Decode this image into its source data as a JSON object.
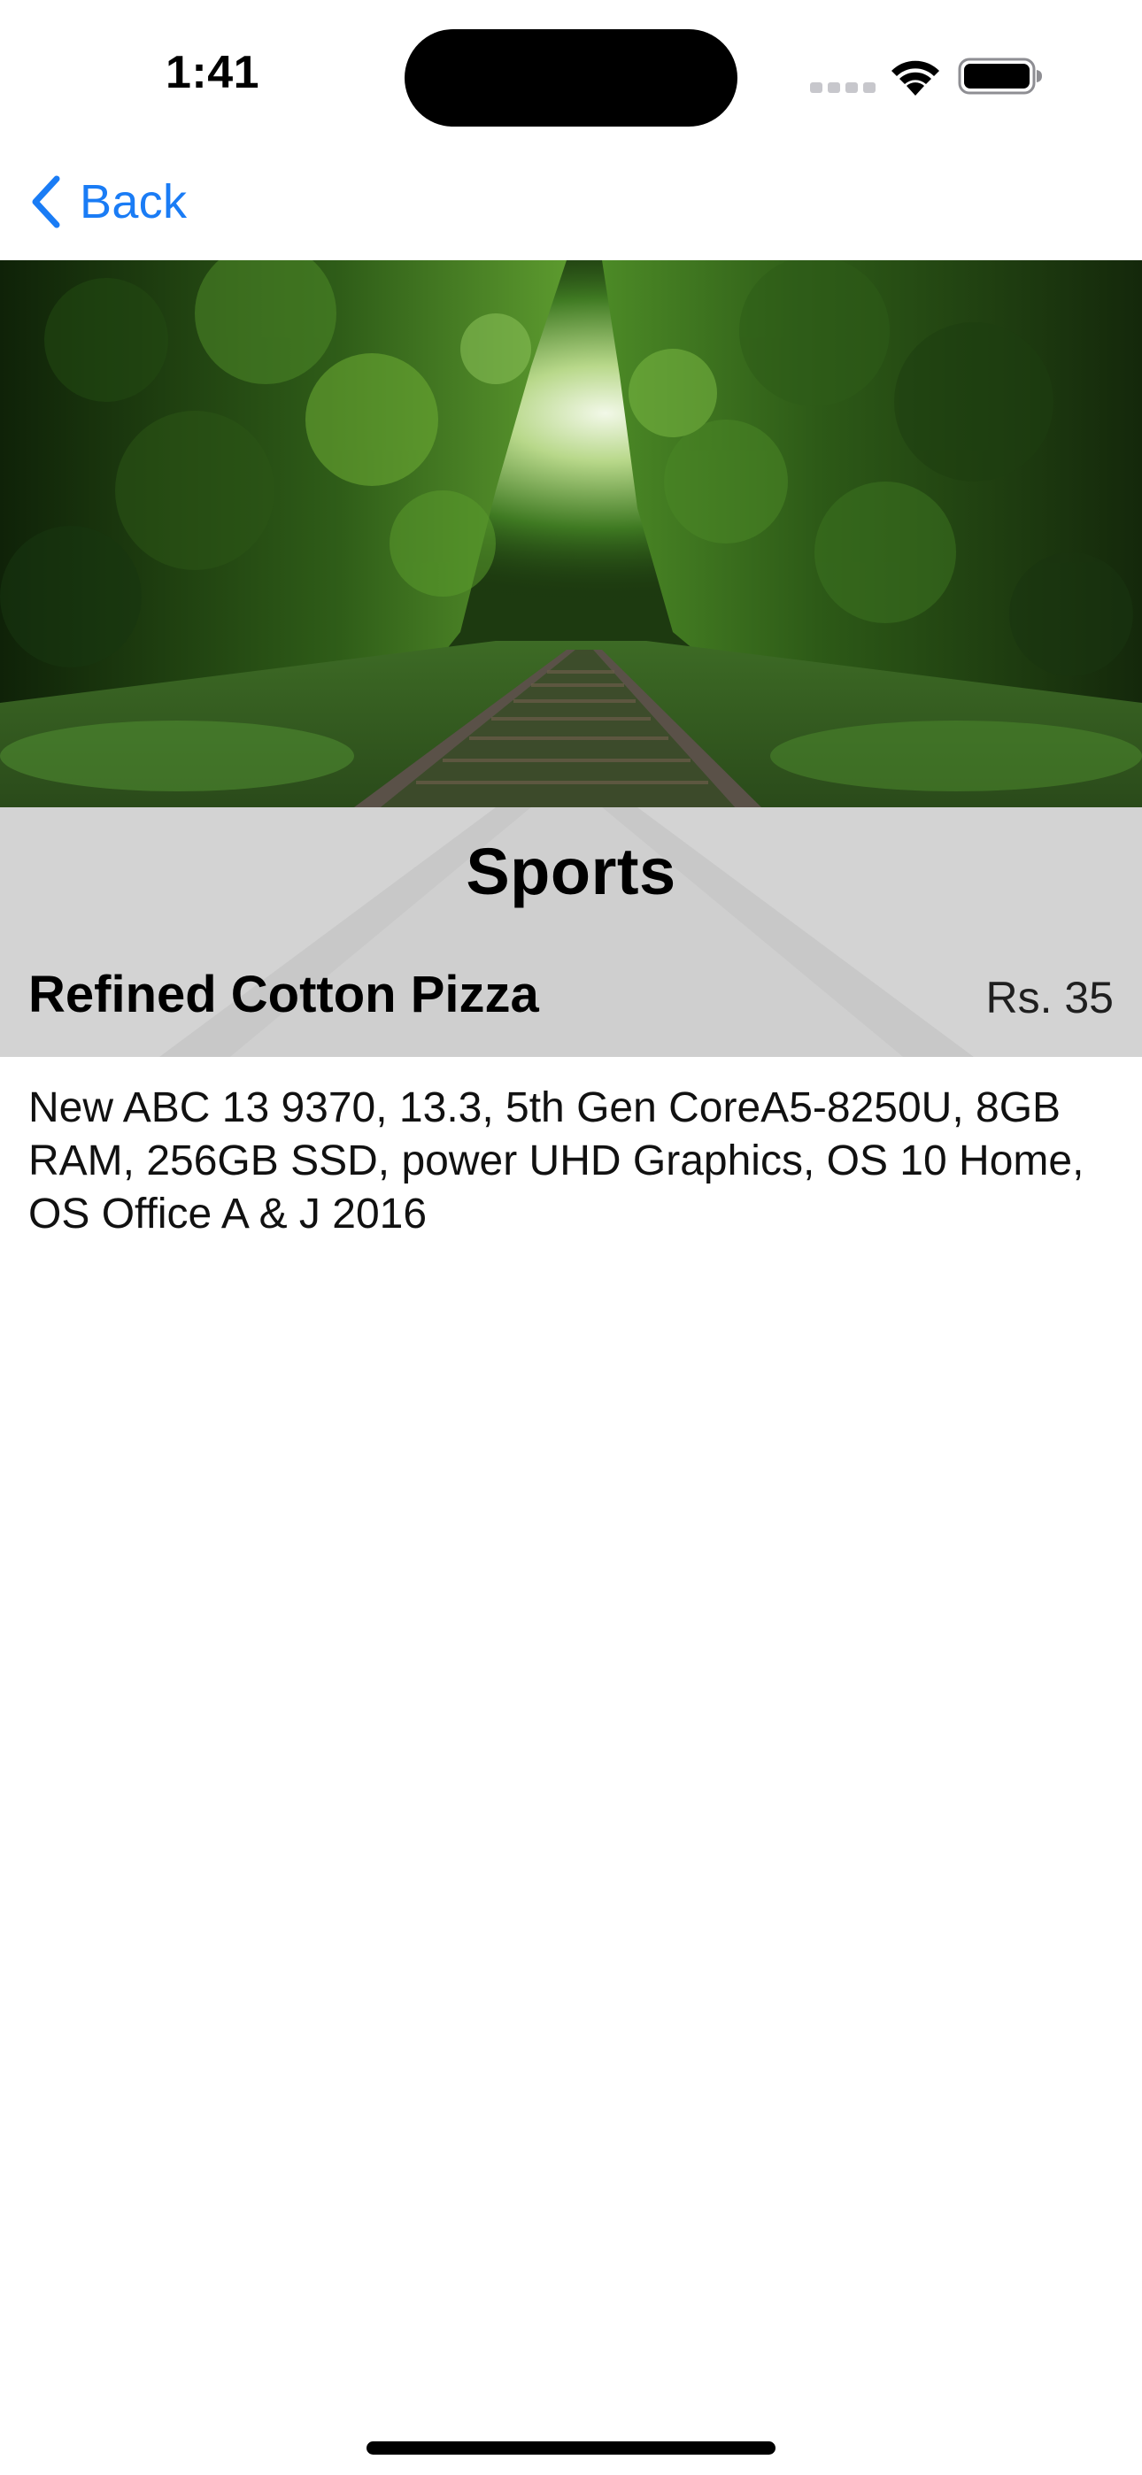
{
  "status_bar": {
    "time": "1:41"
  },
  "nav": {
    "back_label": "Back",
    "back_icon": "chevron-left-icon",
    "accent_color": "#1a7cf5"
  },
  "hero": {
    "image_subject": "forest-railway-photo"
  },
  "category": {
    "title": "Sports"
  },
  "product": {
    "name": "Refined Cotton Pizza",
    "price": "Rs. 35",
    "description": "New ABC 13 9370, 13.3, 5th Gen CoreA5-8250U, 8GB RAM, 256GB SSD, power UHD Graphics, OS 10 Home, OS Office A & J 2016"
  }
}
